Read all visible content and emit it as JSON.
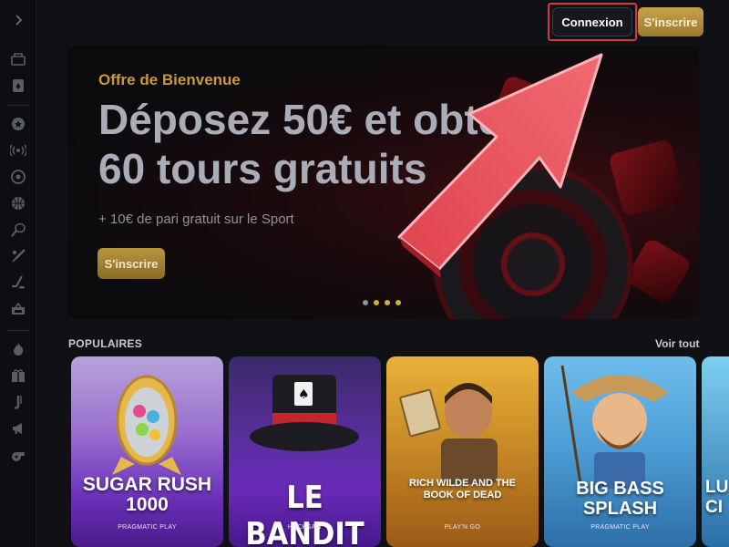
{
  "header": {
    "login_label": "Connexion",
    "signup_label": "S'inscrire"
  },
  "sidebar": {
    "icons": [
      "chevron-right-icon",
      "casino-icon",
      "cards-icon",
      "star-icon",
      "live-icon",
      "soccer-icon",
      "basketball-icon",
      "tennis-icon",
      "baseball-icon",
      "hockey-icon",
      "arena-icon",
      "fire-icon",
      "gift-icon",
      "juventus-icon",
      "megaphone-icon",
      "whistle-icon"
    ]
  },
  "banner": {
    "offer": "Offre de Bienvenue",
    "headline": "Déposez 50€ et obtenez\n60 tours gratuits",
    "subline": "+ 10€ de pari gratuit sur le Sport",
    "cta_label": "S'inscrire",
    "slides": 4,
    "active_slide": 1
  },
  "section": {
    "title": "POPULAIRES",
    "see_all": "Voir tout"
  },
  "games": [
    {
      "title": "SUGAR RUSH\n1000",
      "provider": "PRAGMATIC PLAY"
    },
    {
      "title": "LE BANDIT",
      "provider": "HACKSAW"
    },
    {
      "title": "RICH WILDE AND THE\nBOOK OF DEAD",
      "provider": "PLAY'N GO"
    },
    {
      "title": "BIG BASS\nSPLASH",
      "provider": "PRAGMATIC PLAY"
    },
    {
      "title": "LU\nCI",
      "provider": ""
    }
  ],
  "colors": {
    "accent_gold": "#c99a36",
    "highlight_red": "#d4353f",
    "background": "#101115"
  }
}
